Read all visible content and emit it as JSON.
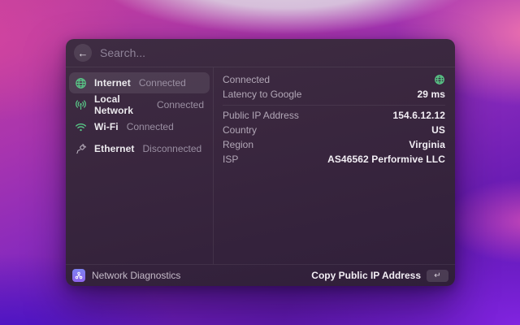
{
  "search": {
    "placeholder": "Search...",
    "back_icon": "arrow-left-icon"
  },
  "sidebar": {
    "items": [
      {
        "label": "Internet",
        "status": "Connected",
        "icon": "globe-icon"
      },
      {
        "label": "Local Network",
        "status": "Connected",
        "icon": "antenna-broadcast-icon"
      },
      {
        "label": "Wi-Fi",
        "status": "Connected",
        "icon": "wifi-icon"
      },
      {
        "label": "Ethernet",
        "status": "Disconnected",
        "icon": "plug-icon"
      }
    ]
  },
  "detail": {
    "connected_label": "Connected",
    "connected_icon": "globe-icon",
    "rows": [
      {
        "label": "Latency to Google",
        "value": "29 ms"
      },
      {
        "label": "Public IP Address",
        "value": "154.6.12.12"
      },
      {
        "label": "Country",
        "value": "US"
      },
      {
        "label": "Region",
        "value": "Virginia"
      },
      {
        "label": "ISP",
        "value": "AS46562 Performive LLC"
      }
    ]
  },
  "footer": {
    "app_icon": "network-nodes-icon",
    "app_name": "Network Diagnostics",
    "action_label": "Copy Public IP Address",
    "action_key": "↵"
  },
  "colors": {
    "accent_green": "#58c586",
    "icon_gray": "#b3aab8",
    "app_icon_purple": "#8b7bf4"
  }
}
